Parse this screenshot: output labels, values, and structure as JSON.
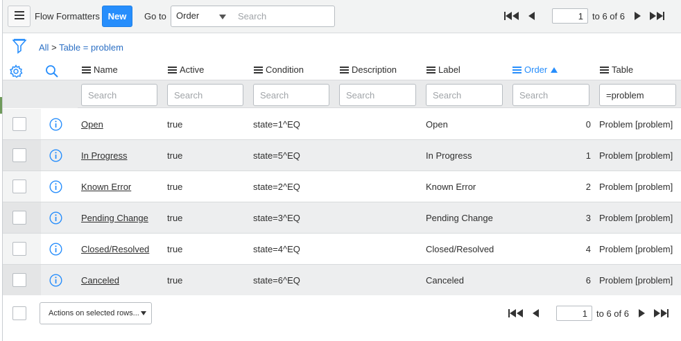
{
  "header": {
    "title": "Flow Formatters",
    "new_label": "New",
    "goto_label": "Go to",
    "goto_field": "Order",
    "search_placeholder": "Search",
    "pager": {
      "current": "1",
      "range_text": "to 6 of 6"
    }
  },
  "breadcrumb": {
    "all": "All",
    "separator": ">",
    "filter": "Table = problem"
  },
  "columns": {
    "name": "Name",
    "active": "Active",
    "condition": "Condition",
    "description": "Description",
    "label": "Label",
    "order": "Order",
    "table": "Table"
  },
  "column_search": {
    "placeholder": "Search",
    "table_value": "=problem"
  },
  "rows": [
    {
      "name": "Open",
      "active": "true",
      "condition": "state=1^EQ",
      "description": "",
      "label": "Open",
      "order": "0",
      "table": "Problem [problem]"
    },
    {
      "name": "In Progress",
      "active": "true",
      "condition": "state=5^EQ",
      "description": "",
      "label": "In Progress",
      "order": "1",
      "table": "Problem [problem]"
    },
    {
      "name": "Known Error",
      "active": "true",
      "condition": "state=2^EQ",
      "description": "",
      "label": "Known Error",
      "order": "2",
      "table": "Problem [problem]"
    },
    {
      "name": "Pending Change",
      "active": "true",
      "condition": "state=3^EQ",
      "description": "",
      "label": "Pending Change",
      "order": "3",
      "table": "Problem [problem]"
    },
    {
      "name": "Closed/Resolved",
      "active": "true",
      "condition": "state=4^EQ",
      "description": "",
      "label": "Closed/Resolved",
      "order": "4",
      "table": "Problem [problem]"
    },
    {
      "name": "Canceled",
      "active": "true",
      "condition": "state=6^EQ",
      "description": "",
      "label": "Canceled",
      "order": "6",
      "table": "Problem [problem]"
    }
  ],
  "footer": {
    "actions_label": "Actions on selected rows...",
    "pager": {
      "current": "1",
      "range_text": "to 6 of 6"
    }
  },
  "colors": {
    "accent": "#278efc",
    "link": "#2b6fc4"
  },
  "icons": {
    "menu": "hamburger-icon",
    "filter": "funnel-icon",
    "settings": "gear-icon",
    "search": "magnifier-icon",
    "info": "info-circle-icon",
    "first": "double-left-arrow-icon",
    "prev": "left-arrow-icon",
    "next": "right-arrow-icon",
    "last": "double-right-arrow-icon"
  }
}
